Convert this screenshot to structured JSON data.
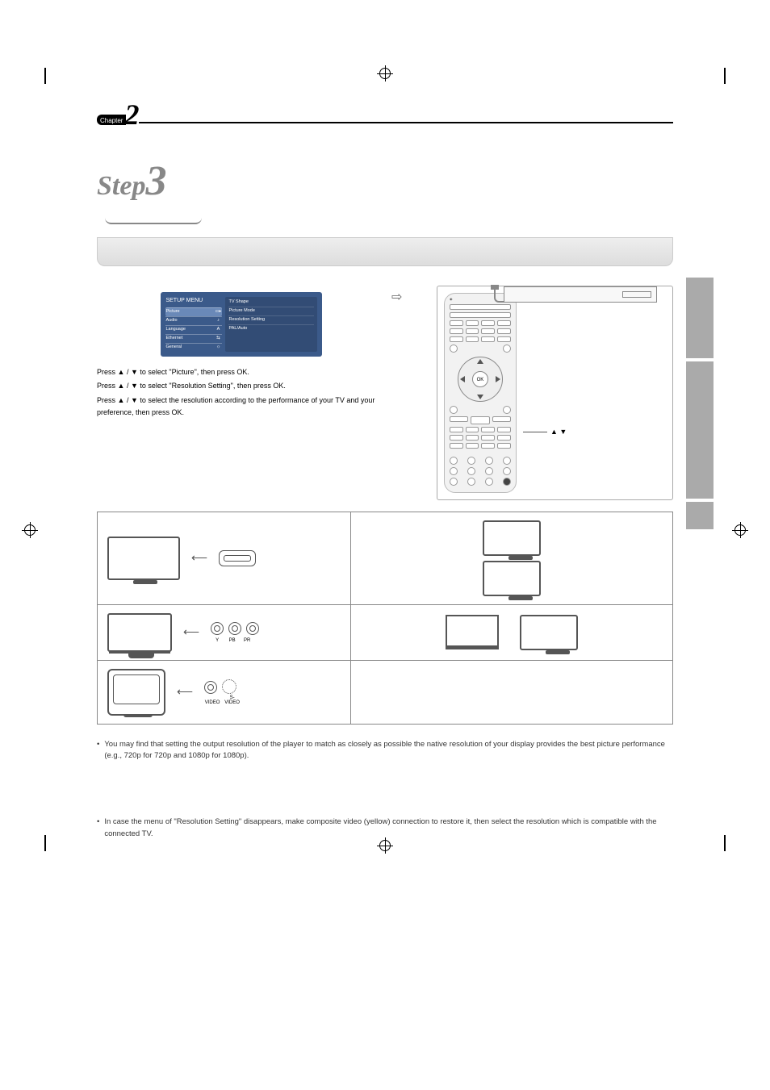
{
  "chapter": {
    "label": "Chapter",
    "number": "2"
  },
  "step": {
    "word": "Step",
    "number": "3"
  },
  "setup_menu": {
    "title": "SETUP MENU",
    "left_items": [
      {
        "label": "Picture",
        "selected": true
      },
      {
        "label": "Audio",
        "selected": false
      },
      {
        "label": "Language",
        "selected": false
      },
      {
        "label": "Ethernet",
        "selected": false
      },
      {
        "label": "General",
        "selected": false
      }
    ],
    "right_items": [
      "TV Shape",
      "Picture Mode",
      "Resolution Setting",
      "PAL/Auto"
    ]
  },
  "instructions": {
    "line1_prefix": "Press ",
    "line1_mid": " / ",
    "line1_suffix": " to select \"Picture\", then press OK.",
    "line2_prefix": "Press ",
    "line2_mid": " / ",
    "line2_suffix": " to select \"Resolution Setting\", then press OK.",
    "line3_prefix": "Press ",
    "line3_mid": " / ",
    "line3_suffix": " to select the resolution according to the performance of your TV and your preference, then press OK."
  },
  "remote": {
    "ok_label": "OK",
    "callout": "▲  ▼"
  },
  "table": {
    "rows": [
      {
        "left_jacks": [
          "HDMI"
        ],
        "right_stack": true
      },
      {
        "left_labels": [
          "Y",
          "PB",
          "PR"
        ],
        "right_proj": true
      },
      {
        "left_labels": [
          "VIDEO",
          "S-VIDEO"
        ],
        "right_empty": true
      }
    ]
  },
  "notes": {
    "n1": "You may find that setting the output resolution of the player to match as closely as possible the native resolution of your display provides the best picture performance (e.g., 720p for 720p and 1080p for 1080p).",
    "n2": "In case the menu of \"Resolution Setting\" disappears, make composite video (yellow) connection to restore it, then select the resolution which is compatible with the connected TV."
  },
  "arrow_glyph": "⇨",
  "tri_up": "▲",
  "tri_down": "▼"
}
